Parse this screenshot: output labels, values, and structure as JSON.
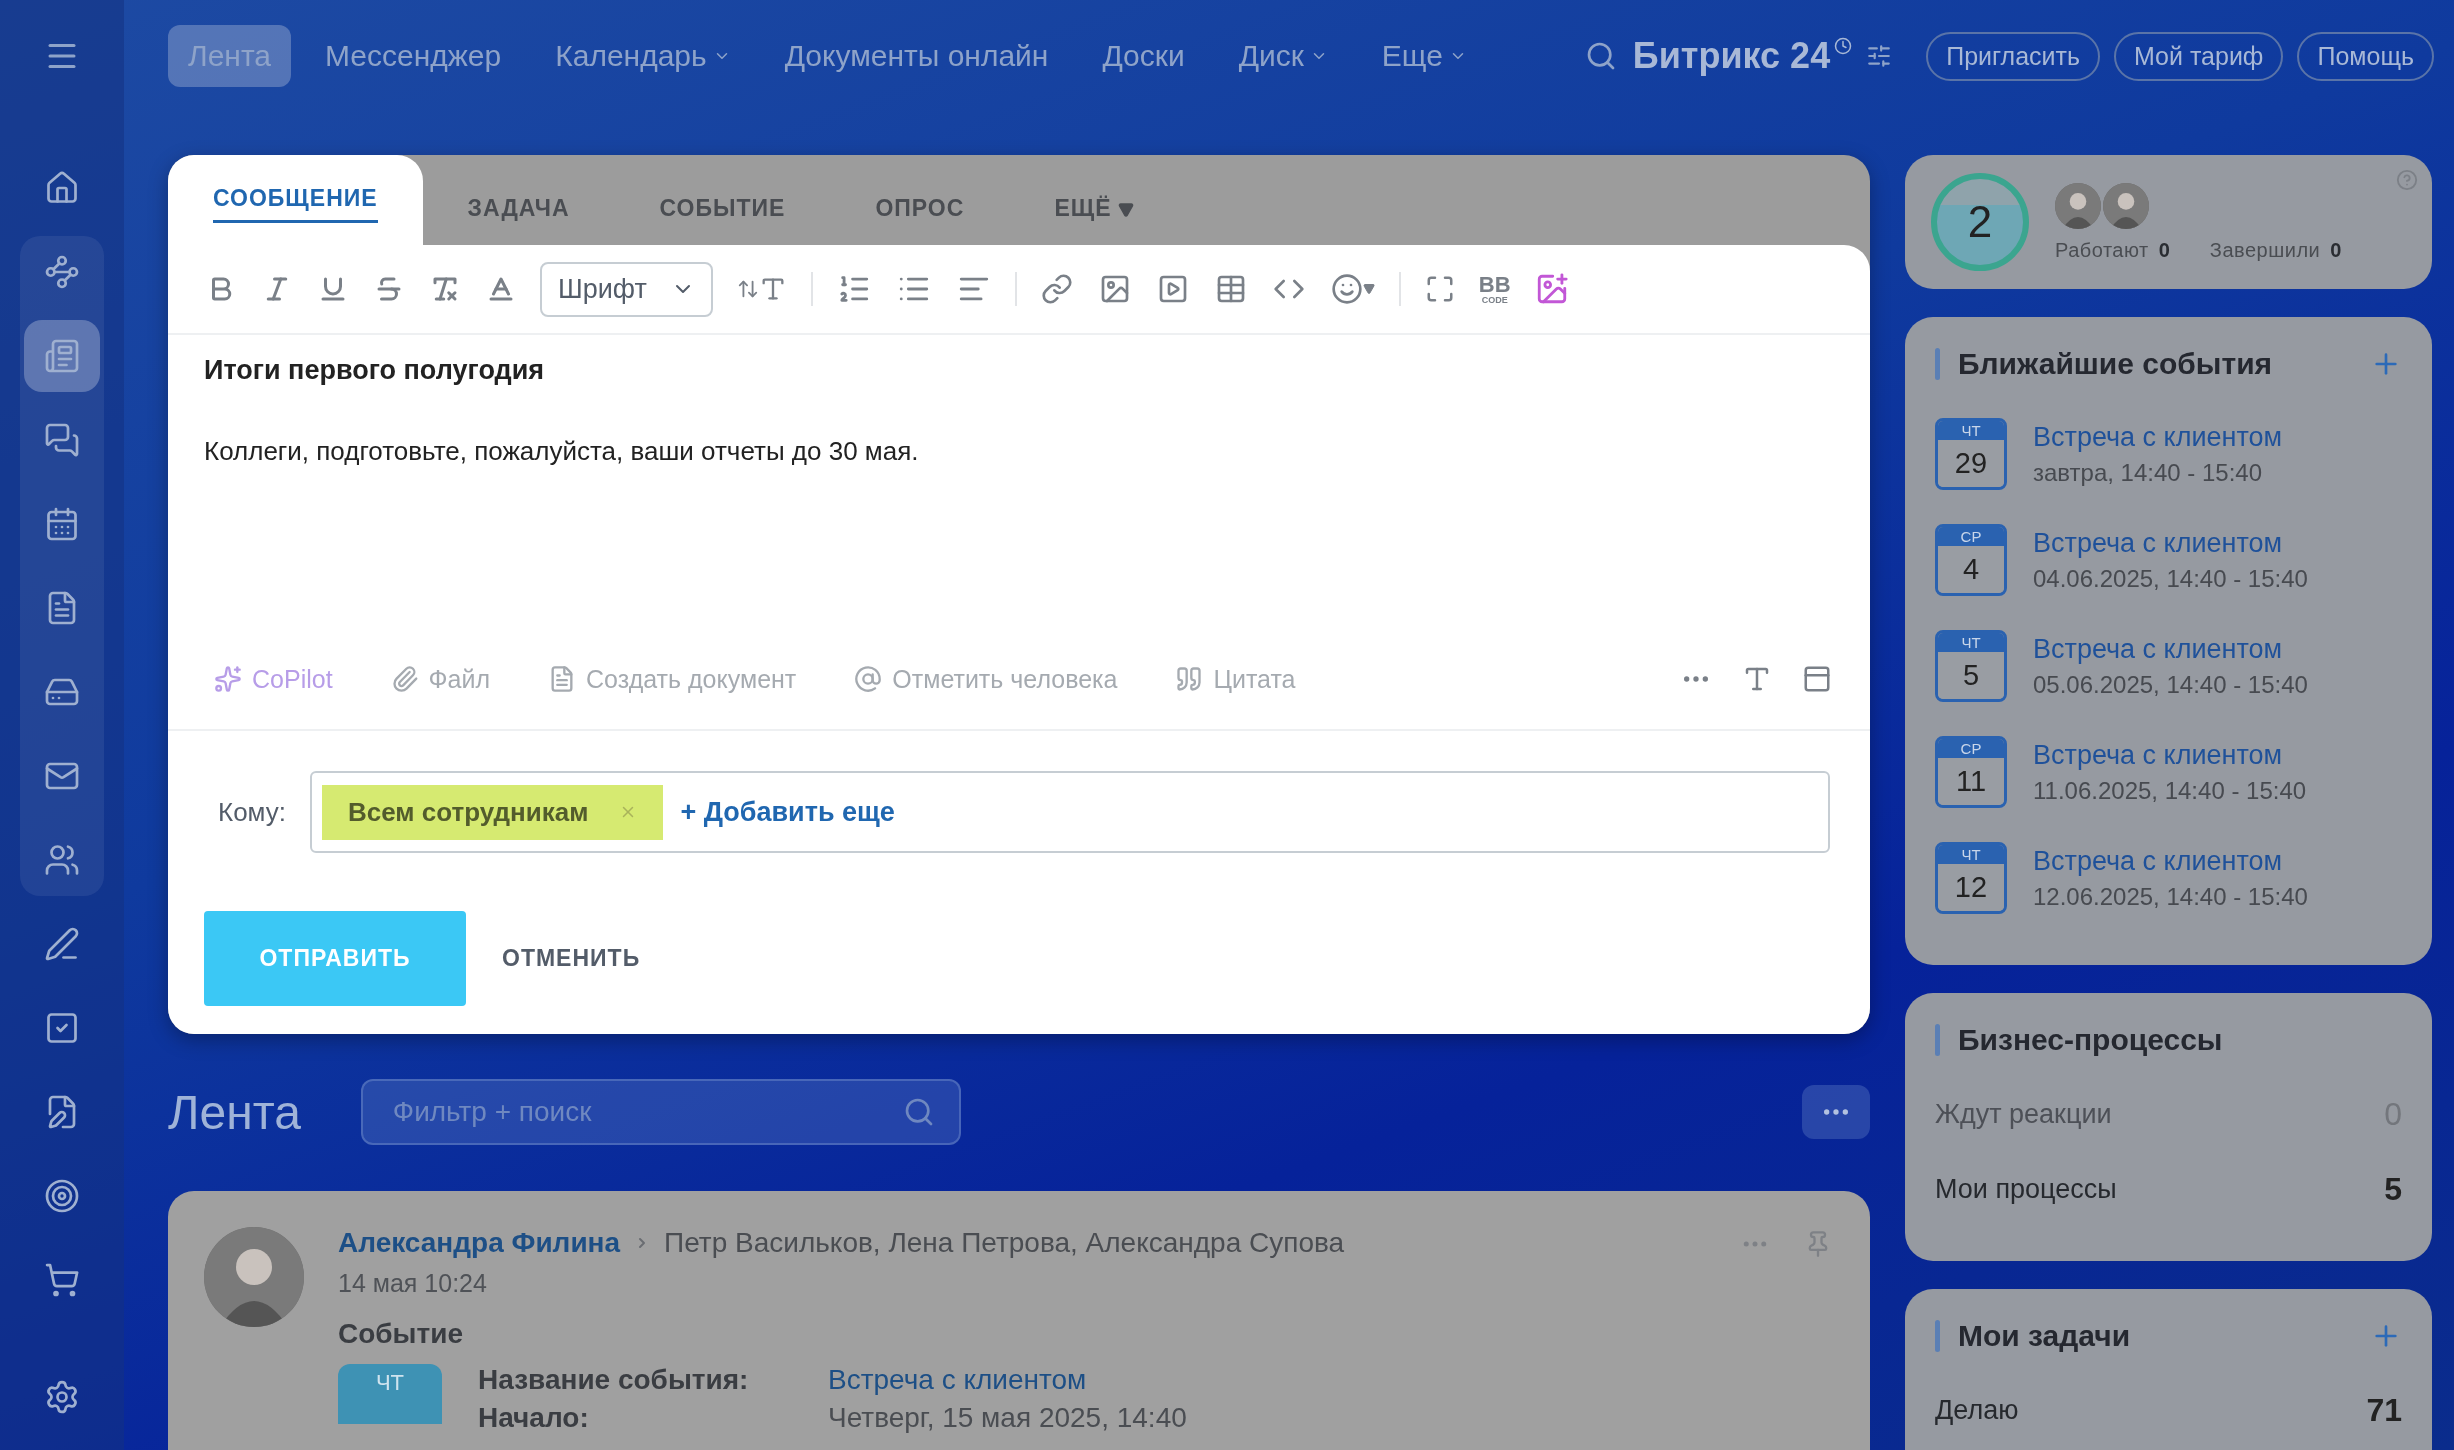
{
  "top_nav": {
    "items": [
      {
        "label": "Лента",
        "selected": true,
        "has_dropdown": false
      },
      {
        "label": "Мессенджер",
        "selected": false,
        "has_dropdown": false
      },
      {
        "label": "Календарь",
        "selected": false,
        "has_dropdown": true
      },
      {
        "label": "Документы онлайн",
        "selected": false,
        "has_dropdown": false
      },
      {
        "label": "Доски",
        "selected": false,
        "has_dropdown": false
      },
      {
        "label": "Диск",
        "selected": false,
        "has_dropdown": true
      },
      {
        "label": "Еще",
        "selected": false,
        "has_dropdown": true
      }
    ],
    "brand": "Битрикс 24",
    "buttons": [
      "Пригласить",
      "Мой тариф",
      "Помощь"
    ]
  },
  "sidebar": {
    "items": [
      {
        "selected": false
      },
      {
        "selected": false
      },
      {
        "selected": true
      },
      {
        "selected": false
      },
      {
        "selected": false
      },
      {
        "selected": false
      },
      {
        "selected": false
      },
      {
        "selected": false
      },
      {
        "selected": false
      },
      {
        "selected": false
      },
      {
        "selected": false
      },
      {
        "selected": false
      },
      {
        "selected": false
      },
      {
        "selected": false
      },
      {
        "selected": false
      }
    ]
  },
  "composer": {
    "tabs": [
      {
        "label": "СООБЩЕНИЕ",
        "selected": true,
        "has_dropdown": false
      },
      {
        "label": "ЗАДАЧА",
        "selected": false,
        "has_dropdown": false
      },
      {
        "label": "СОБЫТИЕ",
        "selected": false,
        "has_dropdown": false
      },
      {
        "label": "ОПРОС",
        "selected": false,
        "has_dropdown": false
      },
      {
        "label": "ЕЩЁ",
        "selected": false,
        "has_dropdown": true
      }
    ],
    "font_select": "Шрифт",
    "bb_label": "BB",
    "bb_sub": "CODE",
    "title": "Итоги первого полугодия",
    "body": "Коллеги, подготовьте, пожалуйста, ваши отчеты до 30 мая.",
    "actions": [
      {
        "label": "CoPilot",
        "kind": "copilot"
      },
      {
        "label": "Файл",
        "kind": "file"
      },
      {
        "label": "Создать документ",
        "kind": "document"
      },
      {
        "label": "Отметить человека",
        "kind": "mention"
      },
      {
        "label": "Цитата",
        "kind": "quote"
      }
    ],
    "recipient": {
      "label": "Кому:",
      "tags": [
        "Всем сотрудникам"
      ],
      "add_link": "+ Добавить еще"
    },
    "send": "ОТПРАВИТЬ",
    "cancel": "ОТМЕНИТЬ"
  },
  "feed": {
    "title": "Лента",
    "search": {
      "placeholder": "Фильтр + поиск"
    },
    "posts": [
      {
        "author": "Александра Филина",
        "recipients": "Петр Васильков, Лена Петрова, Александра Супова",
        "time": "14 мая 10:24",
        "type": "Событие",
        "weekday": "ЧТ",
        "fields": [
          {
            "label": "Название события:",
            "value": "Встреча с клиентом",
            "kind": "link"
          },
          {
            "label": "Начало:",
            "value": "Четверг, 15 мая 2025, 14:40",
            "kind": "text"
          }
        ]
      }
    ]
  },
  "right": {
    "timeman": {
      "count": "2",
      "stats": [
        {
          "label": "Работают",
          "value": "0"
        },
        {
          "label": "Завершили",
          "value": "0"
        }
      ]
    },
    "events": {
      "title": "Ближайшие события",
      "items": [
        {
          "weekday": "ЧТ",
          "day": "29",
          "title": "Встреча с клиентом",
          "time": "завтра, 14:40 - 15:40"
        },
        {
          "weekday": "СР",
          "day": "4",
          "title": "Встреча с клиентом",
          "time": "04.06.2025, 14:40 - 15:40"
        },
        {
          "weekday": "ЧТ",
          "day": "5",
          "title": "Встреча с клиентом",
          "time": "05.06.2025, 14:40 - 15:40"
        },
        {
          "weekday": "СР",
          "day": "11",
          "title": "Встреча с клиентом",
          "time": "11.06.2025, 14:40 - 15:40"
        },
        {
          "weekday": "ЧТ",
          "day": "12",
          "title": "Встреча с клиентом",
          "time": "12.06.2025, 14:40 - 15:40"
        }
      ]
    },
    "processes": {
      "title": "Бизнес-процессы",
      "rows": [
        {
          "label": "Ждут реакции",
          "value": "0",
          "muted": true
        },
        {
          "label": "Мои процессы",
          "value": "5",
          "muted": false
        }
      ]
    },
    "tasks": {
      "title": "Мои задачи",
      "rows": [
        {
          "label": "Делаю",
          "value": "71",
          "muted": false
        }
      ]
    }
  }
}
